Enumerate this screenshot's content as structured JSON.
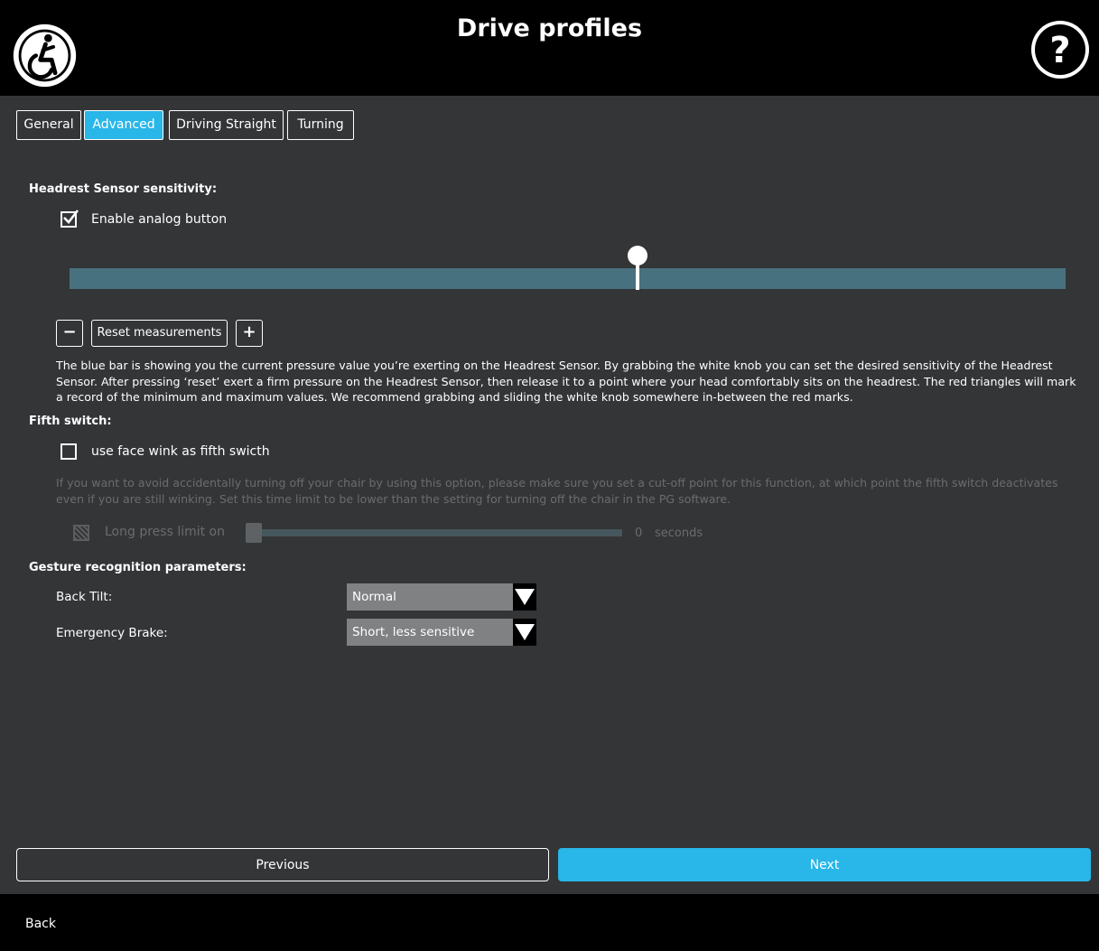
{
  "header": {
    "title": "Drive profiles",
    "logo_icon": "wheelchair-icon",
    "help_icon": "question-icon"
  },
  "tabs": [
    {
      "label": "General",
      "active": false
    },
    {
      "label": "Advanced",
      "active": true
    },
    {
      "label": "Driving Straight",
      "active": false
    },
    {
      "label": "Turning",
      "active": false
    }
  ],
  "headrest": {
    "title": "Headrest Sensor sensitivity:",
    "enable_analog": {
      "label": "Enable analog button",
      "checked": true
    },
    "sensitivity_fraction": 0.57,
    "minus_label": "−",
    "reset_label": "Reset measurements",
    "plus_label": "+",
    "description": "The blue bar is showing you the current pressure value you’re exerting on the Headrest Sensor. By grabbing the white knob you can set the desired sensitivity of the Headrest Sensor. After pressing ‘reset’ exert a firm pressure on the Headrest Sensor, then release it to a point where your head comfortably sits on the headrest. The red triangles will mark a record of the minimum and maximum values. We recommend grabbing and sliding the white knob somewhere in-between the red marks."
  },
  "fifth_switch": {
    "title": "Fifth switch:",
    "face_wink": {
      "label": "use face wink as fifth swicth",
      "checked": false
    },
    "description": "If you want to avoid accidentally turning off your chair by using this option, please make sure you set a cut-off point for this function, at which point the fifth switch deactivates even if you are still winking. Set this time limit to be lower than the setting for turning off the chair in the PG software.",
    "long_press": {
      "label": "Long press limit on",
      "value": "0",
      "unit": "seconds",
      "enabled": false
    }
  },
  "gesture": {
    "title": "Gesture recognition parameters:",
    "back_tilt": {
      "label": "Back Tilt:",
      "value": "Normal"
    },
    "emergency_brake": {
      "label": "Emergency Brake:",
      "value": "Short, less sensitive"
    }
  },
  "nav": {
    "previous_label": "Previous",
    "next_label": "Next"
  },
  "footer": {
    "back_label": "Back"
  },
  "colors": {
    "accent": "#29b6e8",
    "background": "#333537",
    "bar": "#48717f",
    "dim_text": "#6a6c6e"
  }
}
